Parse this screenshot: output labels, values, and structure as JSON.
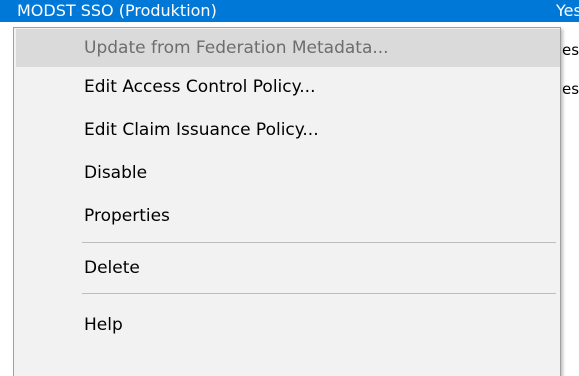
{
  "list": {
    "selected_row": {
      "name": "MODST SSO (Produktion)",
      "enabled": "Yes"
    },
    "background_rows": [
      "es",
      "es"
    ]
  },
  "context_menu": {
    "items": [
      {
        "label": "Update from Federation Metadata...",
        "disabled": true
      },
      {
        "label": "Edit Access Control Policy...",
        "disabled": false
      },
      {
        "label": "Edit Claim Issuance Policy...",
        "disabled": false
      },
      {
        "label": "Disable",
        "disabled": false
      },
      {
        "label": "Properties",
        "disabled": false
      },
      {
        "label": "Delete",
        "disabled": false
      },
      {
        "label": "Help",
        "disabled": false
      }
    ]
  },
  "colors": {
    "selection": "#0078d7",
    "menu_background": "#f2f2f2",
    "disabled_highlight": "#dadada",
    "disabled_text": "#6d6d6d"
  }
}
